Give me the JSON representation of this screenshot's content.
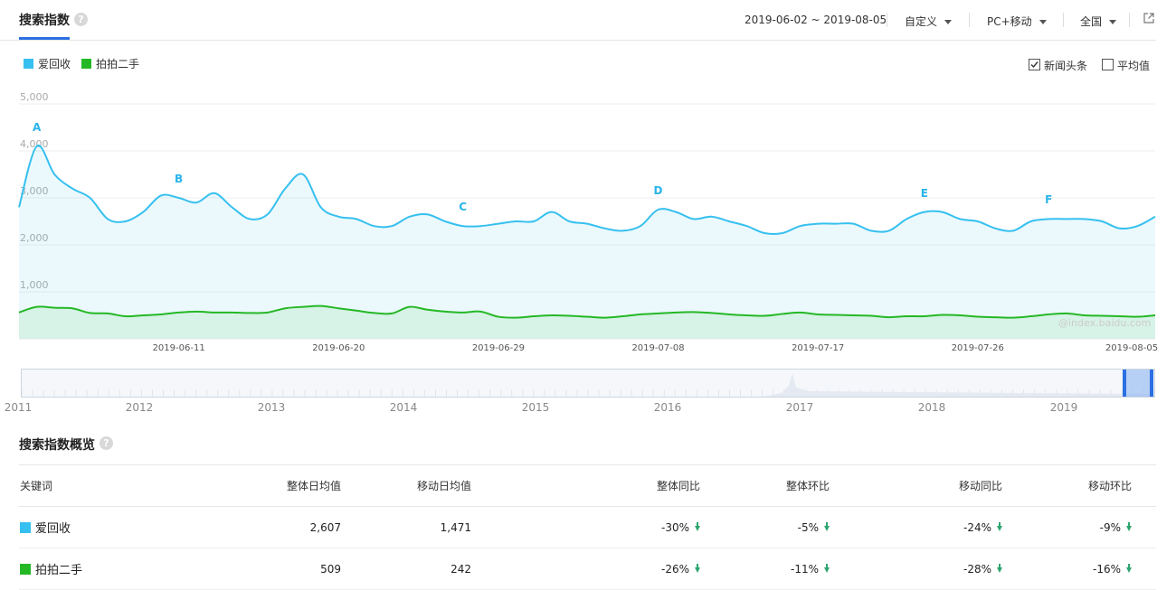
{
  "header": {
    "title": "搜索指数",
    "date_range": "2019-06-02 ~ 2019-08-05",
    "custom_label": "自定义",
    "device_label": "PC+移动",
    "region_label": "全国"
  },
  "legend": {
    "series_a": "爱回收",
    "series_b": "拍拍二手",
    "news_label": "新闻头条",
    "news_checked": true,
    "avg_label": "平均值",
    "avg_checked": false
  },
  "colors": {
    "series_a": "#36c0ef",
    "series_b": "#25b825",
    "accent": "#2b6fe3",
    "down": "#2da56f"
  },
  "chart_data": {
    "type": "area",
    "ylim": [
      0,
      5000
    ],
    "yticks": [
      "5,000",
      "4,000",
      "3,000",
      "2,000",
      "1,000"
    ],
    "x_tick_labels": [
      "2019-06-11",
      "2019-06-20",
      "2019-06-29",
      "2019-07-08",
      "2019-07-17",
      "2019-07-26",
      "2019-08-05"
    ],
    "x_tick_index": [
      9,
      18,
      27,
      36,
      45,
      54,
      64
    ],
    "n_points": 65,
    "series": [
      {
        "name": "爱回收",
        "values": [
          2800,
          4100,
          3500,
          3200,
          3000,
          2550,
          2500,
          2700,
          3050,
          3000,
          2900,
          3100,
          2800,
          2550,
          2650,
          3200,
          3500,
          2800,
          2600,
          2550,
          2400,
          2400,
          2600,
          2650,
          2500,
          2400,
          2400,
          2450,
          2500,
          2500,
          2700,
          2500,
          2450,
          2350,
          2300,
          2400,
          2750,
          2700,
          2550,
          2600,
          2500,
          2400,
          2250,
          2250,
          2400,
          2450,
          2450,
          2450,
          2300,
          2300,
          2550,
          2700,
          2700,
          2550,
          2500,
          2350,
          2300,
          2500,
          2550,
          2550,
          2550,
          2500,
          2350,
          2400,
          2600
        ]
      },
      {
        "name": "拍拍二手",
        "values": [
          560,
          680,
          660,
          650,
          550,
          540,
          480,
          500,
          520,
          560,
          580,
          560,
          560,
          550,
          560,
          650,
          680,
          700,
          650,
          600,
          550,
          540,
          680,
          620,
          580,
          560,
          580,
          470,
          450,
          480,
          500,
          490,
          470,
          450,
          480,
          520,
          540,
          560,
          570,
          550,
          520,
          500,
          490,
          530,
          560,
          520,
          510,
          500,
          490,
          460,
          480,
          480,
          510,
          500,
          470,
          460,
          450,
          480,
          520,
          540,
          500,
          490,
          480,
          470,
          500
        ]
      }
    ],
    "annotations": [
      {
        "label": "A",
        "index": 1
      },
      {
        "label": "B",
        "index": 9
      },
      {
        "label": "C",
        "index": 25
      },
      {
        "label": "D",
        "index": 36
      },
      {
        "label": "E",
        "index": 51
      },
      {
        "label": "F",
        "index": 58
      }
    ],
    "watermark": "@index.baidu.com"
  },
  "slider": {
    "years": [
      "2011",
      "2012",
      "2013",
      "2014",
      "2015",
      "2016",
      "2017",
      "2018",
      "2019"
    ],
    "selected_from": 0.974,
    "selected_to": 0.998
  },
  "overview": {
    "title": "搜索指数概览",
    "columns": [
      "关键词",
      "整体日均值",
      "移动日均值",
      "整体同比",
      "整体环比",
      "移动同比",
      "移动环比"
    ],
    "rows": [
      {
        "keyword": "爱回收",
        "total_avg": "2,607",
        "mobile_avg": "1,471",
        "total_yoy": "-30%",
        "total_mom": "-5%",
        "mobile_yoy": "-24%",
        "mobile_mom": "-9%"
      },
      {
        "keyword": "拍拍二手",
        "total_avg": "509",
        "mobile_avg": "242",
        "total_yoy": "-26%",
        "total_mom": "-11%",
        "mobile_yoy": "-28%",
        "mobile_mom": "-16%"
      }
    ]
  }
}
